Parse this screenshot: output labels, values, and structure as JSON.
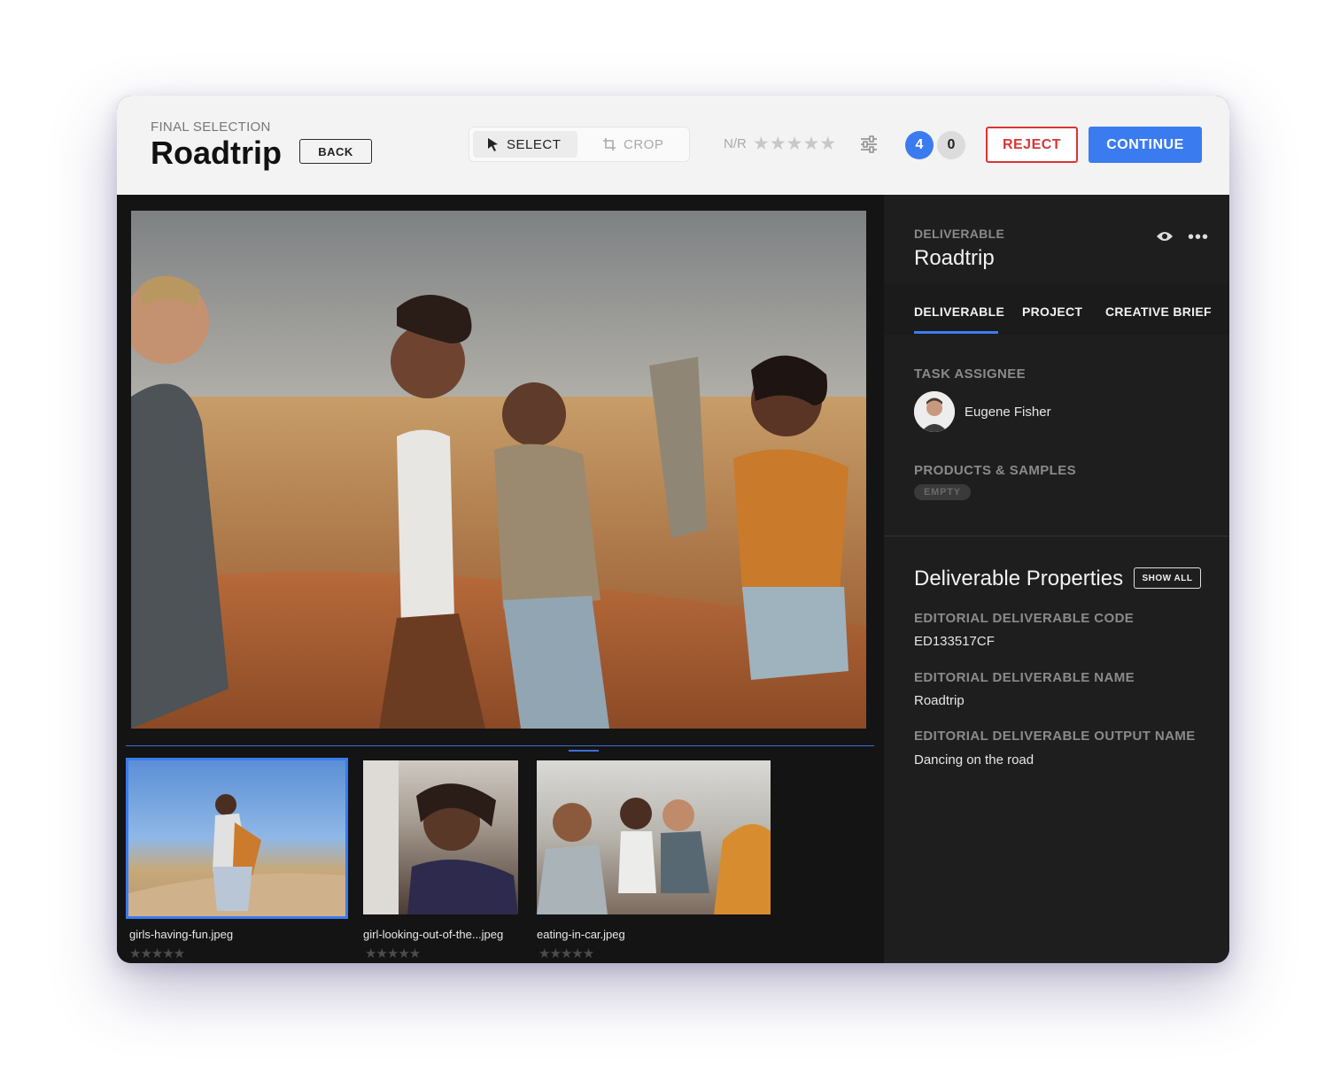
{
  "header": {
    "eyebrow": "FINAL SELECTION",
    "title": "Roadtrip",
    "back_label": "BACK",
    "tools": {
      "select_label": "SELECT",
      "crop_label": "CROP"
    },
    "rating_label": "N/R",
    "rating_stars": "★★★★★",
    "counts": {
      "selected": "4",
      "rejected": "0"
    },
    "reject_label": "REJECT",
    "continue_label": "CONTINUE"
  },
  "thumbnails": [
    {
      "name": "girls-having-fun.jpeg",
      "stars": "★★★★★",
      "selected": true
    },
    {
      "name": "girl-looking-out-of-the...jpeg",
      "stars": "★★★★★",
      "selected": false
    },
    {
      "name": "eating-in-car.jpeg",
      "stars": "★★★★★",
      "selected": false
    }
  ],
  "sidebar": {
    "eyebrow": "DELIVERABLE",
    "title": "Roadtrip",
    "tabs": [
      "DELIVERABLE",
      "PROJECT",
      "CREATIVE BRIEF"
    ],
    "active_tab": "DELIVERABLE",
    "assignee_label": "TASK ASSIGNEE",
    "assignee_name": "Eugene Fisher",
    "products_label": "PRODUCTS & SAMPLES",
    "products_value": "EMPTY",
    "props_title": "Deliverable Properties",
    "show_all_label": "SHOW ALL",
    "properties": [
      {
        "label": "EDITORIAL DELIVERABLE CODE",
        "value": "ED133517CF"
      },
      {
        "label": "EDITORIAL DELIVERABLE NAME",
        "value": "Roadtrip"
      },
      {
        "label": "EDITORIAL DELIVERABLE OUTPUT NAME",
        "value": "Dancing on the road"
      }
    ]
  },
  "colors": {
    "accent": "#3b7bf0",
    "reject": "#d93535",
    "sidebar_bg": "#1e1e1e",
    "viewer_bg": "#141414"
  }
}
